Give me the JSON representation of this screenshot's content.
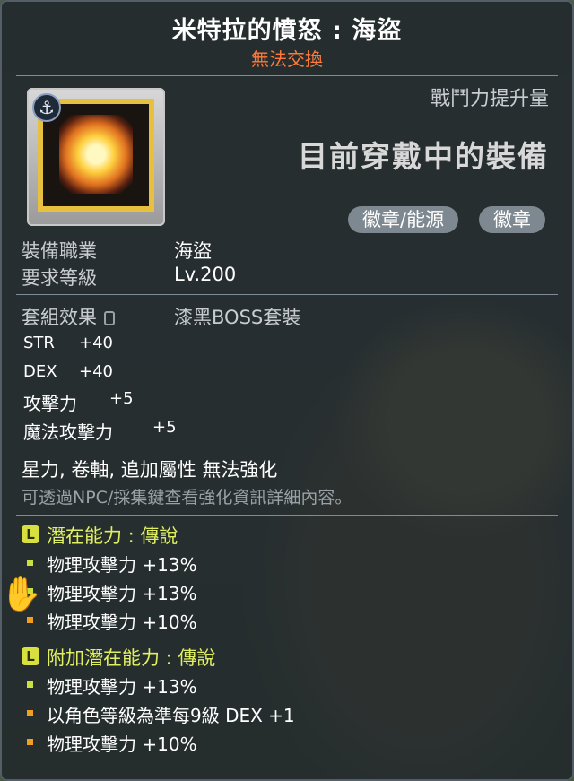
{
  "item": {
    "name": "米特拉的憤怒 : 海盜",
    "trade_status": "無法交換",
    "combat_power_label": "戰鬥力提升量",
    "equipped_label": "目前穿戴中的裝備",
    "tags": [
      "徽章/能源",
      "徽章"
    ]
  },
  "info": {
    "job_label": "裝備職業",
    "job_value": "海盜",
    "level_label": "要求等級",
    "level_value": "Lv.200",
    "set_label": "套組效果",
    "set_value": "漆黑BOSS套裝"
  },
  "stats": [
    {
      "name": "STR",
      "value": "+40"
    },
    {
      "name": "DEX",
      "value": "+40"
    },
    {
      "name": "攻擊力",
      "value": "+5"
    },
    {
      "name": "魔法攻擊力",
      "value": "+5"
    }
  ],
  "restriction": "星力, 卷軸, 追加屬性 無法強化",
  "note": "可透過NPC/採集鍵查看強化資訊詳細內容。",
  "potential": {
    "badge": "L",
    "title": "潛在能力 : 傳說",
    "lines": [
      "物理攻擊力 +13%",
      "物理攻擊力 +13%",
      "物理攻擊力 +10%"
    ]
  },
  "bonus_potential": {
    "badge": "L",
    "title": "附加潛在能力 : 傳說",
    "lines": [
      "物理攻擊力 +13%",
      "以角色等級為準每9級 DEX +1",
      "物理攻擊力 +10%"
    ]
  },
  "colors": {
    "title": "#ffffff",
    "untradeable": "#ff7a3a",
    "potential_title": "#e0f060",
    "legendary_badge": "#d8e040",
    "bullet_green": "#c8e040",
    "bullet_orange": "#f0a020"
  }
}
